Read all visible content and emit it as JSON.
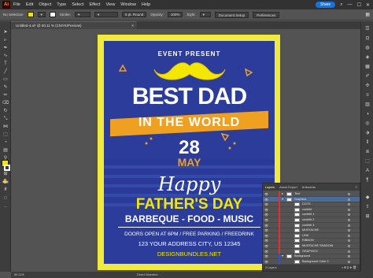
{
  "app": {
    "logo": "Ai"
  },
  "menu": {
    "items": [
      "File",
      "Edit",
      "Object",
      "Type",
      "Select",
      "Effect",
      "View",
      "Window",
      "Help"
    ]
  },
  "titlebar": {
    "share_label": "Share",
    "minimize": "—",
    "maximize": "☐",
    "close": "✕"
  },
  "controlbar": {
    "selection_label": "No Selection",
    "stroke_label": "Stroke:",
    "brush_label": "5 pt. Round",
    "opacity_label": "Opacity:",
    "opacity_value": "100%",
    "style_label": "Style:",
    "document_setup": "Document Setup",
    "preferences": "Preferences",
    "fill_color": "#f3e600",
    "stroke_color": "#ffffff"
  },
  "document": {
    "tab_title": "Untitled-4.ai* @ 60.11 % (CMYK/Preview)",
    "close": "×"
  },
  "poster": {
    "event_present": "EVENT PRESENT",
    "best_dad": "BEST DAD",
    "in_the_world": "IN THE WORLD",
    "day": "28",
    "month": "MAY",
    "happy": "Happy",
    "fathers_day": "FATHER'S DAY",
    "activities": "BARBEQUE - FOOD - MUSIC",
    "doors": "DOORS OPEN AT 6PM / FREE PARKING / FREEDRINK",
    "address": "123 YOUR ADDRESS CITY, US 12345",
    "website": "DESIGNBUNDLES.NET",
    "colors": {
      "background": "#2b3c9a",
      "yellow": "#f3e600",
      "orange": "#f0a020",
      "border": "#f1ea3c"
    }
  },
  "layers_panel": {
    "tabs": [
      "Layers",
      "Asset Export",
      "Artboards"
    ],
    "active_tab": "Layers",
    "rows": [
      {
        "name": "Text",
        "color": "#e03030",
        "indent": 0,
        "expanded": false
      },
      {
        "name": "Graphics",
        "color": "#e03030",
        "indent": 0,
        "expanded": true,
        "selected": true
      },
      {
        "name": "DOTS",
        "color": "#e03030",
        "indent": 1
      },
      {
        "name": "confetti",
        "color": "#e03030",
        "indent": 1
      },
      {
        "name": "confetti 1",
        "color": "#e03030",
        "indent": 1
      },
      {
        "name": "confetti 2",
        "color": "#e03030",
        "indent": 1
      },
      {
        "name": "confetti 3",
        "color": "#e03030",
        "indent": 1
      },
      {
        "name": "MUSTACHE",
        "color": "#e03030",
        "indent": 1
      },
      {
        "name": "LINK",
        "color": "#e03030",
        "indent": 1
      },
      {
        "name": "RIBBON",
        "color": "#e03030",
        "indent": 1
      },
      {
        "name": "MUSTACHE SHADOW",
        "color": "#e03030",
        "indent": 1
      },
      {
        "name": "GRAPHICS",
        "color": "#e03030",
        "indent": 1
      },
      {
        "name": "Background",
        "color": "#3050e0",
        "indent": 0,
        "expanded": true
      },
      {
        "name": "Background Color 2",
        "color": "#3050e0",
        "indent": 1
      },
      {
        "name": "Background Color 1",
        "color": "#3050e0",
        "indent": 1
      }
    ],
    "footer": "3 Layers"
  },
  "statusbar": {
    "zoom": "60.11%",
    "tool": "Direct Selection"
  }
}
